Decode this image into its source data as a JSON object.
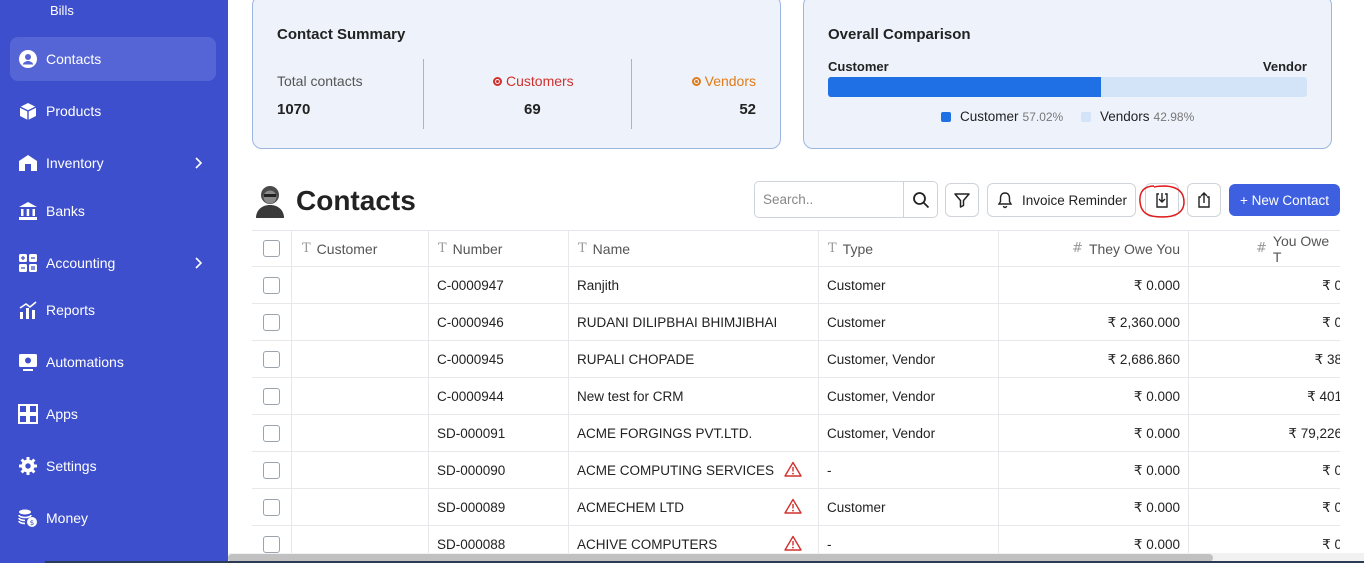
{
  "sidebar": {
    "bills_label": "Bills",
    "items": [
      {
        "label": "Contacts",
        "icon": "contacts-icon",
        "active": true
      },
      {
        "label": "Products",
        "icon": "products-icon"
      },
      {
        "label": "Inventory",
        "icon": "inventory-icon",
        "has_submenu": true
      },
      {
        "label": "Banks",
        "icon": "bank-icon"
      },
      {
        "label": "Accounting",
        "icon": "accounting-icon",
        "has_submenu": true
      },
      {
        "label": "Reports",
        "icon": "reports-icon"
      },
      {
        "label": "Automations",
        "icon": "automations-icon"
      },
      {
        "label": "Apps",
        "icon": "apps-icon"
      },
      {
        "label": "Settings",
        "icon": "settings-icon"
      },
      {
        "label": "Money",
        "icon": "money-icon"
      }
    ]
  },
  "summary": {
    "title": "Contact Summary",
    "total_label": "Total contacts",
    "total_value": "1070",
    "customers_label": "Customers",
    "customers_value": "69",
    "vendors_label": "Vendors",
    "vendors_value": "52"
  },
  "comparison": {
    "title": "Overall Comparison",
    "left_label": "Customer",
    "right_label": "Vendor",
    "customer_fraction": 0.5702,
    "legend_customer": "Customer",
    "legend_customer_pct": "57.02%",
    "legend_vendor": "Vendors",
    "legend_vendor_pct": "42.98%"
  },
  "contacts": {
    "title": "Contacts",
    "search_placeholder": "Search..",
    "reminder_label": "Invoice Reminder",
    "new_contact_label": "+ New Contact",
    "columns": [
      "Customer",
      "Number",
      "Name",
      "Type",
      "They Owe You",
      "You Owe T"
    ],
    "rows": [
      {
        "number": "C-0000947",
        "name": "Ranjith",
        "type": "Customer",
        "they_owe": "₹ 0.000",
        "you_owe": "₹ 0",
        "warn": false
      },
      {
        "number": "C-0000946",
        "name": "RUDANI DILIPBHAI BHIMJIBHAI",
        "type": "Customer",
        "they_owe": "₹ 2,360.000",
        "you_owe": "₹ 0",
        "warn": false
      },
      {
        "number": "C-0000945",
        "name": "RUPALI CHOPADE",
        "type": "Customer, Vendor",
        "they_owe": "₹ 2,686.860",
        "you_owe": "₹ 38",
        "warn": false
      },
      {
        "number": "C-0000944",
        "name": "New test for CRM",
        "type": "Customer, Vendor",
        "they_owe": "₹ 0.000",
        "you_owe": "₹ 401",
        "warn": false
      },
      {
        "number": "SD-000091",
        "name": "ACME FORGINGS PVT.LTD.",
        "type": "Customer, Vendor",
        "they_owe": "₹ 0.000",
        "you_owe": "₹ 79,226",
        "warn": false
      },
      {
        "number": "SD-000090",
        "name": "ACME COMPUTING SERVICES",
        "type": "-",
        "they_owe": "₹ 0.000",
        "you_owe": "₹ 0",
        "warn": true
      },
      {
        "number": "SD-000089",
        "name": "ACMECHEM LTD",
        "type": "Customer",
        "they_owe": "₹ 0.000",
        "you_owe": "₹ 0",
        "warn": true
      },
      {
        "number": "SD-000088",
        "name": "ACHIVE COMPUTERS",
        "type": "-",
        "they_owe": "₹ 0.000",
        "you_owe": "₹ 0",
        "warn": true
      }
    ]
  },
  "colors": {
    "sidebar": "#3d4fcc",
    "accent": "#3d5fe0",
    "customer_red": "#d0312d",
    "vendor_orange": "#e07b1a",
    "warning": "#d0312d"
  }
}
